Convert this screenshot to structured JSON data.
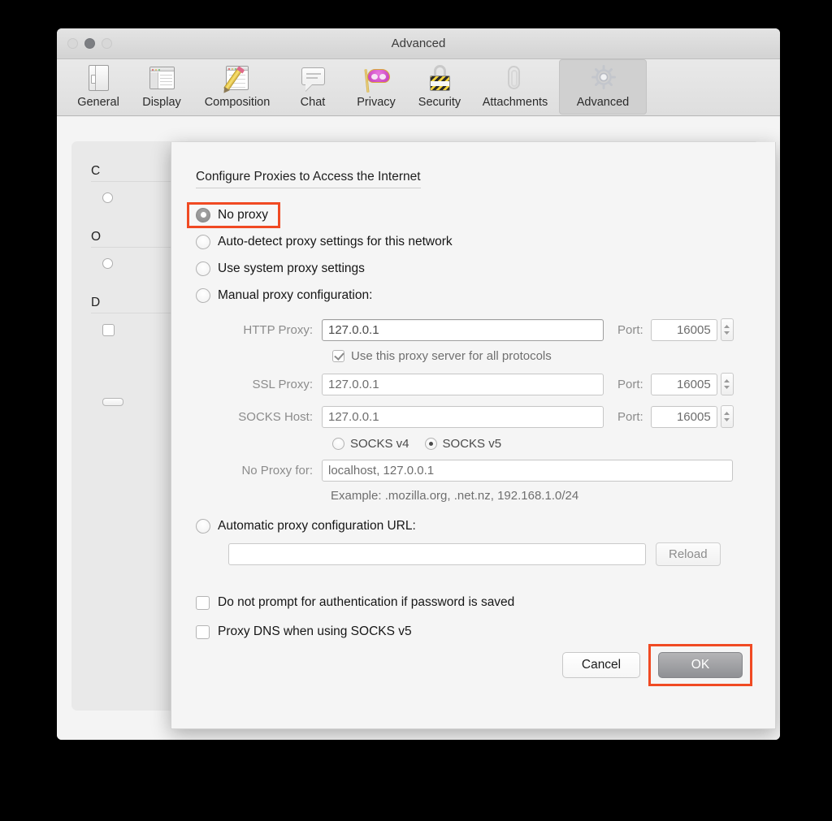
{
  "window": {
    "title": "Advanced",
    "traffic_lights": [
      "close-button",
      "minimize-button",
      "zoom-button"
    ]
  },
  "toolbar": {
    "items": [
      {
        "label": "General",
        "icon": "general-icon",
        "selected": false
      },
      {
        "label": "Display",
        "icon": "display-icon",
        "selected": false
      },
      {
        "label": "Composition",
        "icon": "composition-icon",
        "selected": false
      },
      {
        "label": "Chat",
        "icon": "chat-icon",
        "selected": false
      },
      {
        "label": "Privacy",
        "icon": "privacy-mask-icon",
        "selected": false
      },
      {
        "label": "Security",
        "icon": "security-lock-icon",
        "selected": false
      },
      {
        "label": "Attachments",
        "icon": "paperclip-icon",
        "selected": false
      },
      {
        "label": "Advanced",
        "icon": "gear-icon",
        "selected": true
      }
    ]
  },
  "background_panel": {
    "heading_1": "C",
    "heading_2": "O",
    "heading_3": "D",
    "fragment_1": "",
    "fragment_2": "",
    "fragment_3": "",
    "button_fragment": ""
  },
  "dialog": {
    "title": "Configure Proxies to Access the Internet",
    "proxy_mode_options": [
      {
        "label": "No proxy",
        "selected": true,
        "highlighted": true
      },
      {
        "label": "Auto-detect proxy settings for this network",
        "selected": false,
        "highlighted": false
      },
      {
        "label": "Use system proxy settings",
        "selected": false,
        "highlighted": false
      },
      {
        "label": "Manual proxy configuration:",
        "selected": false,
        "highlighted": false
      }
    ],
    "fields": {
      "http_proxy": {
        "label": "HTTP Proxy:",
        "value": "127.0.0.1",
        "port_label": "Port:",
        "port": "16005"
      },
      "ssl_proxy": {
        "label": "SSL Proxy:",
        "value": "127.0.0.1",
        "port_label": "Port:",
        "port": "16005"
      },
      "socks_host": {
        "label": "SOCKS Host:",
        "value": "127.0.0.1",
        "port_label": "Port:",
        "port": "16005"
      },
      "no_proxy_for": {
        "label": "No Proxy for:",
        "value": "localhost, 127.0.0.1"
      }
    },
    "use_for_all_protocols": {
      "label": "Use this proxy server for all protocols",
      "checked": true
    },
    "socks_version": {
      "v4_label": "SOCKS v4",
      "v5_label": "SOCKS v5",
      "selected": "SOCKS v5"
    },
    "example_text": "Example: .mozilla.org, .net.nz, 192.168.1.0/24",
    "auto_config": {
      "label": "Automatic proxy configuration URL:",
      "selected": false,
      "url_value": "",
      "reload_label": "Reload"
    },
    "options": [
      {
        "label": "Do not prompt for authentication if password is saved",
        "checked": false
      },
      {
        "label": "Proxy DNS when using SOCKS v5",
        "checked": false
      }
    ],
    "buttons": {
      "cancel_label": "Cancel",
      "ok_label": "OK",
      "ok_highlighted": true
    }
  },
  "colors": {
    "highlight": "#f04a23",
    "window_bg": "#ececec",
    "sheet_bg": "#f5f5f5",
    "selected_tab_bg": "#d0d0d0"
  }
}
